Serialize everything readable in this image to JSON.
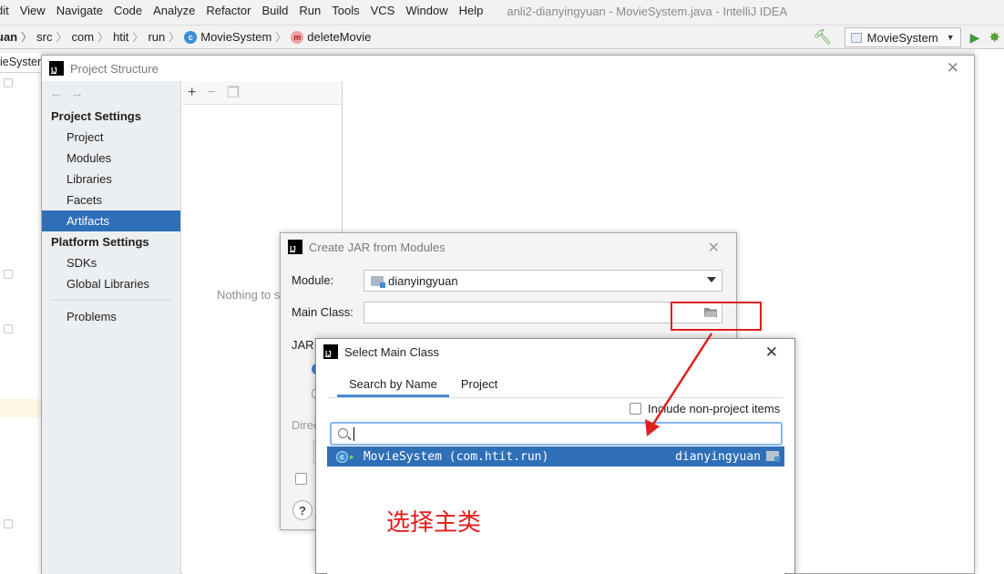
{
  "menubar": {
    "items": [
      "dit",
      "View",
      "Navigate",
      "Code",
      "Analyze",
      "Refactor",
      "Build",
      "Run",
      "Tools",
      "VCS",
      "Window",
      "Help"
    ],
    "window_title": "anli2-dianyingyuan - MovieSystem.java - IntelliJ IDEA"
  },
  "breadcrumb": {
    "items": [
      "uan",
      "src",
      "com",
      "htit",
      "run",
      "MovieSystem",
      "deleteMovie"
    ]
  },
  "toolbar": {
    "run_config": "MovieSystem"
  },
  "editor": {
    "tab_label": "ieSystem"
  },
  "project_structure": {
    "title": "Project Structure",
    "project_settings_header": "Project Settings",
    "project_settings_items": [
      "Project",
      "Modules",
      "Libraries",
      "Facets",
      "Artifacts"
    ],
    "selected_item": "Artifacts",
    "platform_settings_header": "Platform Settings",
    "platform_settings_items": [
      "SDKs",
      "Global Libraries"
    ],
    "problems": "Problems",
    "empty_text": "Nothing to s"
  },
  "create_jar": {
    "title": "Create JAR from Modules",
    "module_label": "Module:",
    "module_value": "dianyingyuan",
    "main_class_label": "Main Class:",
    "main_class_value": "",
    "jar_partial": "JAR",
    "dir_partial": "Direc"
  },
  "select_main_class": {
    "title": "Select Main Class",
    "tabs": [
      "Search by Name",
      "Project"
    ],
    "active_tab": "Search by Name",
    "include_label": "Include non-project items",
    "include_checked": false,
    "search_value": "",
    "result_class": "MovieSystem (com.htit.run)",
    "result_module": "dianyingyuan"
  },
  "annotation": {
    "text": "选择主类",
    "color": "#e8191b"
  }
}
